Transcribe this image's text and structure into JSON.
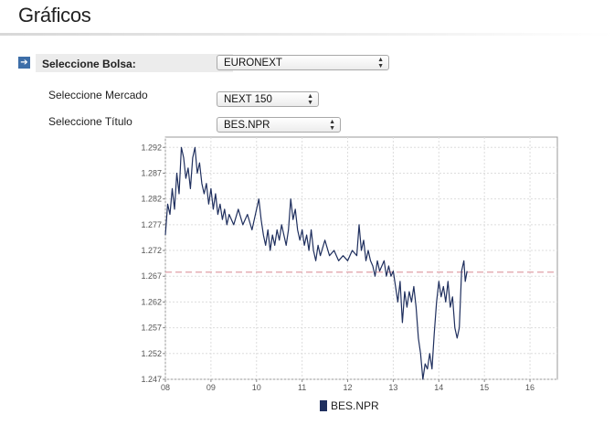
{
  "header": {
    "title": "Gráficos"
  },
  "form": {
    "bolsa": {
      "label": "Seleccione Bolsa:",
      "value": "EURONEXT"
    },
    "mercado": {
      "label": "Seleccione Mercado",
      "value": "NEXT 150"
    },
    "titulo": {
      "label": "Seleccione Título",
      "value": "BES.NPR"
    }
  },
  "chart_data": {
    "type": "line",
    "title": "",
    "xlabel": "",
    "ylabel": "",
    "x_ticks": [
      "08",
      "09",
      "10",
      "11",
      "12",
      "13",
      "14",
      "15",
      "16"
    ],
    "xlim": [
      8,
      16.6
    ],
    "ylim": [
      1.247,
      1.294
    ],
    "y_ticks": [
      "1.247",
      "1.252",
      "1.257",
      "1.262",
      "1.267",
      "1.272",
      "1.277",
      "1.282",
      "1.287",
      "1.292"
    ],
    "grid": true,
    "reference_line": {
      "y": 1.2678,
      "color": "#e0a0a8",
      "style": "dashed"
    },
    "line_color": "#1f2f5e",
    "series": [
      {
        "name": "BES.NPR",
        "points": [
          [
            8.0,
            1.275
          ],
          [
            8.05,
            1.281
          ],
          [
            8.1,
            1.279
          ],
          [
            8.15,
            1.284
          ],
          [
            8.2,
            1.28
          ],
          [
            8.25,
            1.287
          ],
          [
            8.3,
            1.283
          ],
          [
            8.35,
            1.292
          ],
          [
            8.4,
            1.29
          ],
          [
            8.45,
            1.286
          ],
          [
            8.5,
            1.288
          ],
          [
            8.55,
            1.284
          ],
          [
            8.6,
            1.29
          ],
          [
            8.65,
            1.292
          ],
          [
            8.7,
            1.287
          ],
          [
            8.75,
            1.289
          ],
          [
            8.8,
            1.285
          ],
          [
            8.85,
            1.283
          ],
          [
            8.9,
            1.285
          ],
          [
            8.95,
            1.281
          ],
          [
            9.0,
            1.284
          ],
          [
            9.05,
            1.28
          ],
          [
            9.1,
            1.283
          ],
          [
            9.15,
            1.279
          ],
          [
            9.2,
            1.281
          ],
          [
            9.25,
            1.278
          ],
          [
            9.3,
            1.28
          ],
          [
            9.35,
            1.277
          ],
          [
            9.4,
            1.279
          ],
          [
            9.5,
            1.277
          ],
          [
            9.6,
            1.28
          ],
          [
            9.7,
            1.277
          ],
          [
            9.8,
            1.279
          ],
          [
            9.9,
            1.276
          ],
          [
            10.0,
            1.28
          ],
          [
            10.05,
            1.282
          ],
          [
            10.1,
            1.278
          ],
          [
            10.15,
            1.275
          ],
          [
            10.2,
            1.273
          ],
          [
            10.25,
            1.276
          ],
          [
            10.3,
            1.272
          ],
          [
            10.35,
            1.275
          ],
          [
            10.4,
            1.273
          ],
          [
            10.45,
            1.276
          ],
          [
            10.5,
            1.274
          ],
          [
            10.55,
            1.277
          ],
          [
            10.6,
            1.275
          ],
          [
            10.65,
            1.273
          ],
          [
            10.7,
            1.276
          ],
          [
            10.75,
            1.282
          ],
          [
            10.8,
            1.278
          ],
          [
            10.85,
            1.28
          ],
          [
            10.9,
            1.276
          ],
          [
            10.95,
            1.274
          ],
          [
            11.0,
            1.276
          ],
          [
            11.05,
            1.273
          ],
          [
            11.1,
            1.275
          ],
          [
            11.15,
            1.272
          ],
          [
            11.2,
            1.276
          ],
          [
            11.25,
            1.272
          ],
          [
            11.3,
            1.27
          ],
          [
            11.35,
            1.273
          ],
          [
            11.4,
            1.271
          ],
          [
            11.5,
            1.274
          ],
          [
            11.6,
            1.271
          ],
          [
            11.7,
            1.272
          ],
          [
            11.8,
            1.27
          ],
          [
            11.9,
            1.271
          ],
          [
            12.0,
            1.27
          ],
          [
            12.1,
            1.272
          ],
          [
            12.2,
            1.271
          ],
          [
            12.25,
            1.277
          ],
          [
            12.3,
            1.272
          ],
          [
            12.35,
            1.274
          ],
          [
            12.4,
            1.27
          ],
          [
            12.45,
            1.272
          ],
          [
            12.5,
            1.27
          ],
          [
            12.55,
            1.269
          ],
          [
            12.6,
            1.267
          ],
          [
            12.65,
            1.27
          ],
          [
            12.7,
            1.268
          ],
          [
            12.8,
            1.27
          ],
          [
            12.85,
            1.267
          ],
          [
            12.9,
            1.269
          ],
          [
            12.95,
            1.267
          ],
          [
            13.0,
            1.268
          ],
          [
            13.05,
            1.265
          ],
          [
            13.1,
            1.262
          ],
          [
            13.15,
            1.266
          ],
          [
            13.2,
            1.258
          ],
          [
            13.25,
            1.264
          ],
          [
            13.3,
            1.261
          ],
          [
            13.35,
            1.264
          ],
          [
            13.4,
            1.262
          ],
          [
            13.45,
            1.265
          ],
          [
            13.5,
            1.261
          ],
          [
            13.55,
            1.255
          ],
          [
            13.6,
            1.252
          ],
          [
            13.65,
            1.247
          ],
          [
            13.7,
            1.25
          ],
          [
            13.75,
            1.249
          ],
          [
            13.8,
            1.252
          ],
          [
            13.85,
            1.249
          ],
          [
            13.9,
            1.256
          ],
          [
            13.95,
            1.262
          ],
          [
            14.0,
            1.266
          ],
          [
            14.05,
            1.263
          ],
          [
            14.1,
            1.265
          ],
          [
            14.15,
            1.262
          ],
          [
            14.2,
            1.266
          ],
          [
            14.25,
            1.261
          ],
          [
            14.3,
            1.263
          ],
          [
            14.35,
            1.257
          ],
          [
            14.4,
            1.255
          ],
          [
            14.45,
            1.257
          ],
          [
            14.5,
            1.268
          ],
          [
            14.55,
            1.27
          ],
          [
            14.58,
            1.266
          ],
          [
            14.62,
            1.268
          ]
        ]
      }
    ]
  }
}
